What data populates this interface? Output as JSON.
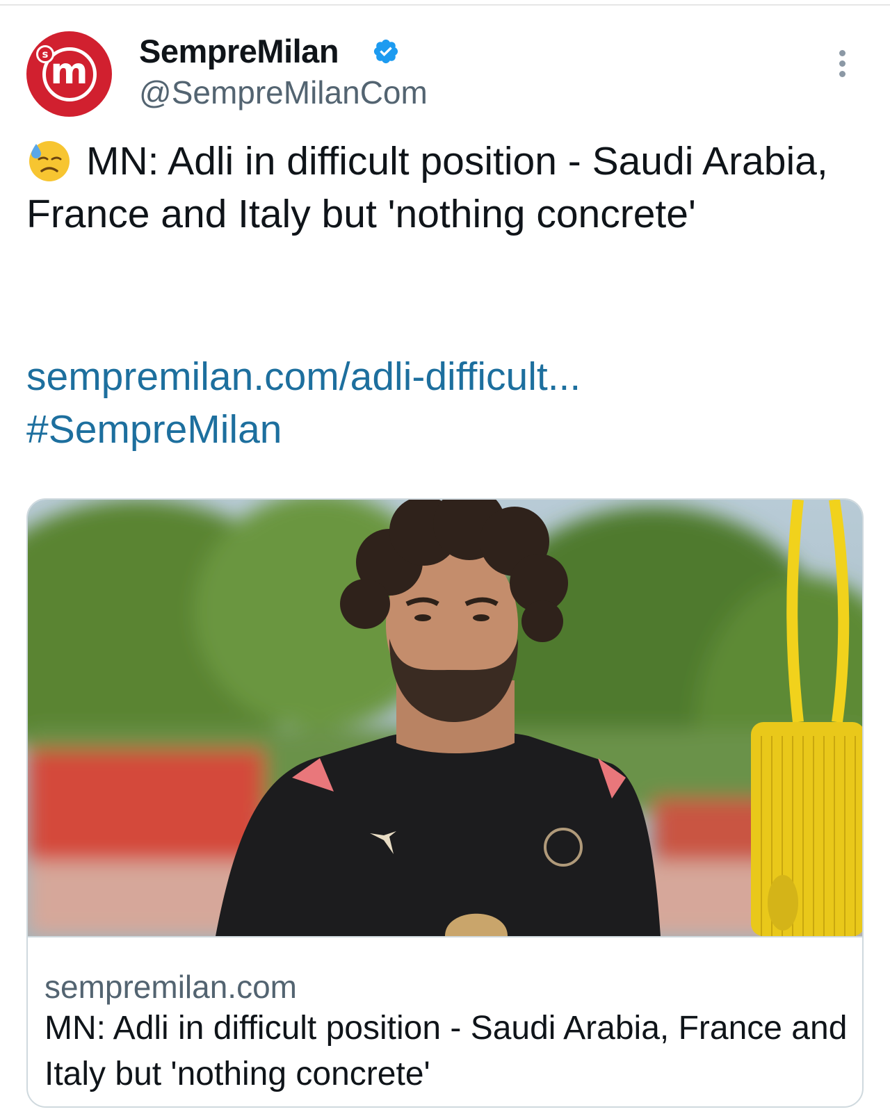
{
  "account": {
    "display_name": "SempreMilan",
    "handle": "@SempreMilanCom",
    "avatar_letter": "m",
    "avatar_badge_letter": "s",
    "verified": true,
    "brand_color": "#d1202f",
    "verified_color": "#1d9bf0"
  },
  "tweet": {
    "emoji": "downcast-face-with-sweat-icon",
    "text": "MN: Adli in difficult position - Saudi Arabia, France and Italy but 'nothing concrete'",
    "link": "sempremilan.com/adli-difficult...",
    "hashtag": "#SempreMilan",
    "link_color": "#1d6f9e"
  },
  "card": {
    "domain": "sempremilan.com",
    "title": "MN: Adli in difficult position - Saudi Arabia, France and Italy but 'nothing concrete'",
    "image": "player-photo"
  },
  "icons": {
    "more": "more-options-icon",
    "verified": "verified-badge-icon"
  }
}
